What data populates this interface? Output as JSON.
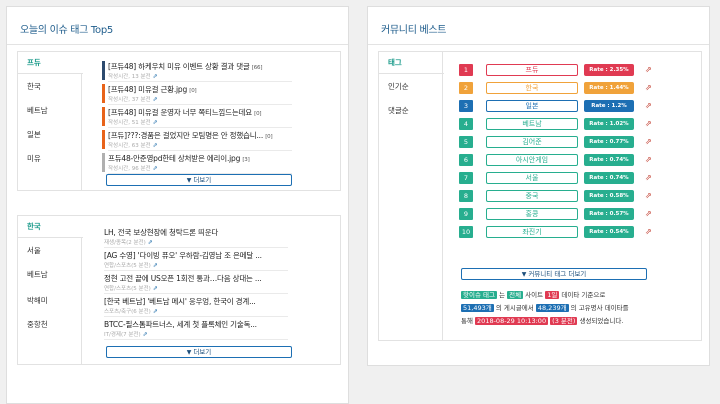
{
  "left_panel": {
    "title": "오늘의 이슈 태그 Top5",
    "box1": {
      "tabs": [
        "프듀",
        "한국",
        "베트남",
        "일본",
        "미유"
      ],
      "items": [
        {
          "title": "[프듀48] 하케우치 미유 이벤트 상황 결과 댓글",
          "count": "[66]",
          "meta": "작성시간, 13 분전",
          "color": "#2c4a6e"
        },
        {
          "title": "[프듀48] 미유걸 근황.jpg",
          "count": "[0]",
          "meta": "작성시간, 37 분전",
          "color": "#e8631a"
        },
        {
          "title": "[프듀48] 미유걸 운영자 너무 쪽티느낌드는데요",
          "count": "[0]",
          "meta": "작성시간, 51 분전",
          "color": "#e8631a"
        },
        {
          "title": "[프듀]???:경품은 걸었지만 모팀명은 안 정했습니...",
          "count": "[0]",
          "meta": "작성시간, 63 분전",
          "color": "#e8631a"
        },
        {
          "title": "프듀48-안준영pd한테 상처받은 에리이.jpg",
          "count": "[3]",
          "meta": "작성시간, 96 분전",
          "color": "#b0b0b0"
        }
      ],
      "more_label": "더보기"
    },
    "box2": {
      "tabs": [
        "한국",
        "서울",
        "베트남",
        "박해미",
        "중항천"
      ],
      "items": [
        {
          "title": "LH, 전국 보상현장에 청탁드론 띄운다",
          "meta": "재생/종목(2 분전)"
        },
        {
          "title": "[AG 수영] '다이빙 퓨오' 우하람-김영남 조 은메달 ...",
          "meta": "연합/스포츠(5 분전)"
        },
        {
          "title": "정현 고전 끝에 US오픈 1회전 통과…다음 상대는 ...",
          "meta": "연합/스포츠(5 분전)"
        },
        {
          "title": "[한국 베트남] '베트남 메시' 응우엉, 한국이 경계...",
          "meta": "스포츠/축구(6 분전)"
        },
        {
          "title": "BTCC-필스톰파트너스, 세계 첫 플록체인 기술독...",
          "meta": "IT/경제(7 분전)"
        }
      ],
      "more_label": "더보기"
    }
  },
  "right_panel": {
    "title": "커뮤니티 베스트",
    "tabs": [
      "태그",
      "인기순",
      "댓글순"
    ],
    "ranks": [
      {
        "num": "1",
        "keyword": "프듀",
        "rate": "Rate : 2.35%",
        "color": "#e03a52"
      },
      {
        "num": "2",
        "keyword": "한국",
        "rate": "Rate : 1.44%",
        "color": "#f0a23a"
      },
      {
        "num": "3",
        "keyword": "일본",
        "rate": "Rate : 1.2%",
        "color": "#1d6fb3"
      },
      {
        "num": "4",
        "keyword": "베트남",
        "rate": "Rate : 1.02%",
        "color": "#27ae8f"
      },
      {
        "num": "5",
        "keyword": "김어준",
        "rate": "Rate : 0.77%",
        "color": "#27ae8f"
      },
      {
        "num": "6",
        "keyword": "아시안게임",
        "rate": "Rate : 0.74%",
        "color": "#27ae8f"
      },
      {
        "num": "7",
        "keyword": "서울",
        "rate": "Rate : 0.74%",
        "color": "#27ae8f"
      },
      {
        "num": "8",
        "keyword": "중국",
        "rate": "Rate : 0.58%",
        "color": "#27ae8f"
      },
      {
        "num": "9",
        "keyword": "홍콩",
        "rate": "Rate : 0.57%",
        "color": "#27ae8f"
      },
      {
        "num": "10",
        "keyword": "좌진기",
        "rate": "Rate : 0.54%",
        "color": "#27ae8f"
      }
    ],
    "more_label": "커뮤니티 태그 더보기",
    "info": {
      "l1_tag": "핫이슈 태그",
      "l1_a": "는",
      "l1_b": "전체",
      "l1_c": "사이트",
      "l1_d": "1일",
      "l1_e": "데이타 기준으로",
      "l2_a": "51,493개",
      "l2_b": "의 게시글에서",
      "l2_c": "48,239개",
      "l2_d": "의 고유명사 데이타를",
      "l3_a": "통해",
      "l3_b": "2018-08-29 10:13:00",
      "l3_c": "(3 분전)",
      "l3_d": "생성되었습니다."
    }
  }
}
